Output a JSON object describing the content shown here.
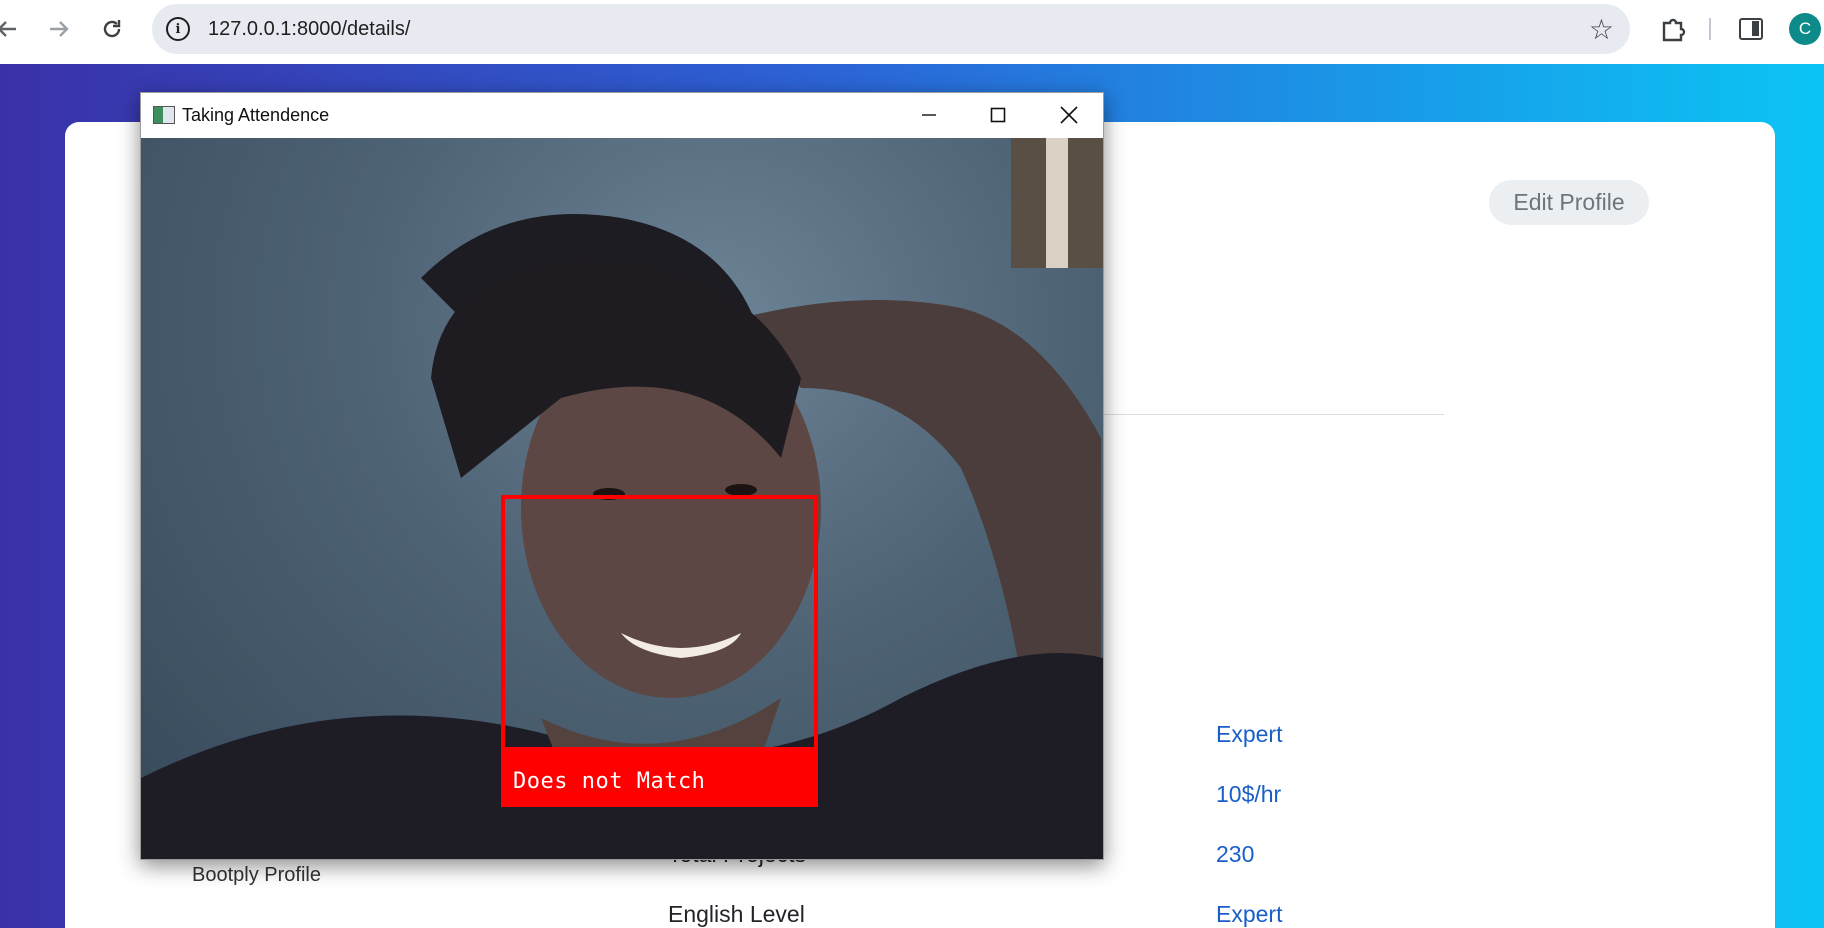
{
  "browser": {
    "url": "127.0.0.1:8000/details/",
    "back_icon": "arrow-left-icon",
    "forward_icon": "arrow-right-icon",
    "reload_icon": "reload-icon",
    "site_info_icon": "info-icon",
    "bookmark_icon": "star-icon",
    "extensions_icon": "puzzle-icon",
    "side_panel_icon": "side-panel-icon",
    "profile_initial": "C"
  },
  "page": {
    "edit_profile_label": "Edit Profile",
    "bootply_text": "Bootply Profile",
    "details": [
      {
        "label": "",
        "value": "Expert"
      },
      {
        "label": "",
        "value": "10$/hr"
      },
      {
        "label": "Total Projects",
        "value": "230"
      },
      {
        "label": "English Level",
        "value": "Expert"
      }
    ]
  },
  "window": {
    "title": "Taking Attendence",
    "face_label": "Does not Match",
    "colors": {
      "face_box": "#ff0000"
    }
  },
  "colors": {
    "gradient_start": "#3a31a8",
    "gradient_end": "#0bc4f5",
    "link_value": "#1a5fc6",
    "avatar": "#0d8a8a"
  }
}
